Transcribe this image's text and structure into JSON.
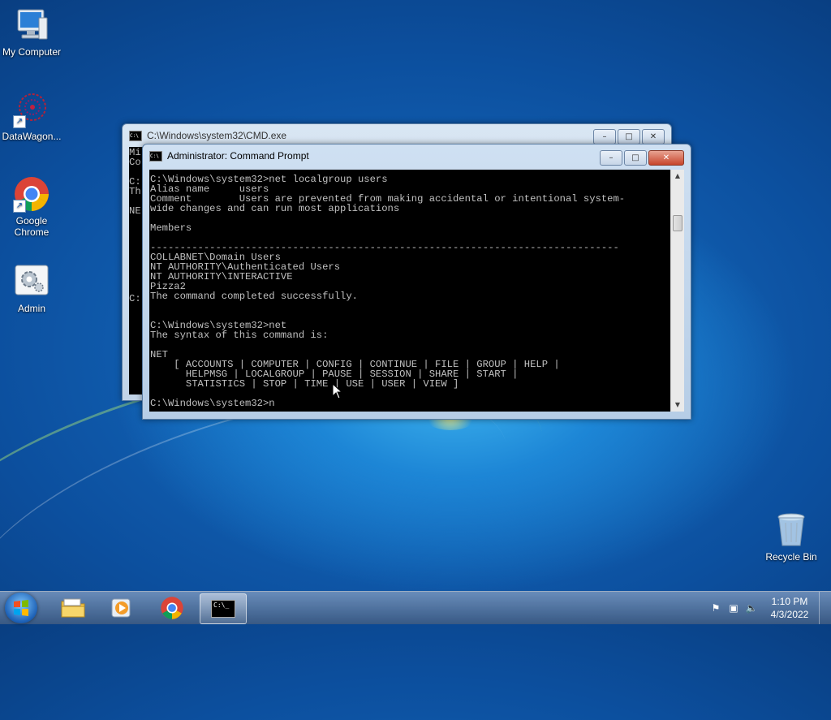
{
  "desktop": {
    "icons": [
      {
        "label": "My Computer"
      },
      {
        "label": "DataWagon..."
      },
      {
        "label": "Google\nChrome"
      },
      {
        "label": "Admin"
      },
      {
        "label": "Recycle Bin"
      }
    ]
  },
  "back_window": {
    "title": "C:\\Windows\\system32\\CMD.exe",
    "visible_lines": [
      "Mi",
      "Co",
      "",
      "C:",
      "Th",
      "",
      "NE",
      "",
      "",
      "",
      "",
      "",
      "",
      "",
      "",
      "C:"
    ]
  },
  "front_window": {
    "title": "Administrator: Command Prompt",
    "console_lines": [
      "C:\\Windows\\system32>net localgroup users",
      "Alias name     users",
      "Comment        Users are prevented from making accidental or intentional system-",
      "wide changes and can run most applications",
      "",
      "Members",
      "",
      "-------------------------------------------------------------------------------",
      "COLLABNET\\Domain Users",
      "NT AUTHORITY\\Authenticated Users",
      "NT AUTHORITY\\INTERACTIVE",
      "Pizza2",
      "The command completed successfully.",
      "",
      "",
      "C:\\Windows\\system32>net",
      "The syntax of this command is:",
      "",
      "NET",
      "    [ ACCOUNTS | COMPUTER | CONFIG | CONTINUE | FILE | GROUP | HELP |",
      "      HELPMSG | LOCALGROUP | PAUSE | SESSION | SHARE | START |",
      "      STATISTICS | STOP | TIME | USE | USER | VIEW ]",
      "",
      "C:\\Windows\\system32>n"
    ]
  },
  "window_controls": {
    "minimize": "–",
    "maximize": "□",
    "close": "✕"
  },
  "taskbar": {
    "time": "1:10 PM",
    "date": "4/3/2022",
    "cmd_icon_text": "C:\\_"
  }
}
